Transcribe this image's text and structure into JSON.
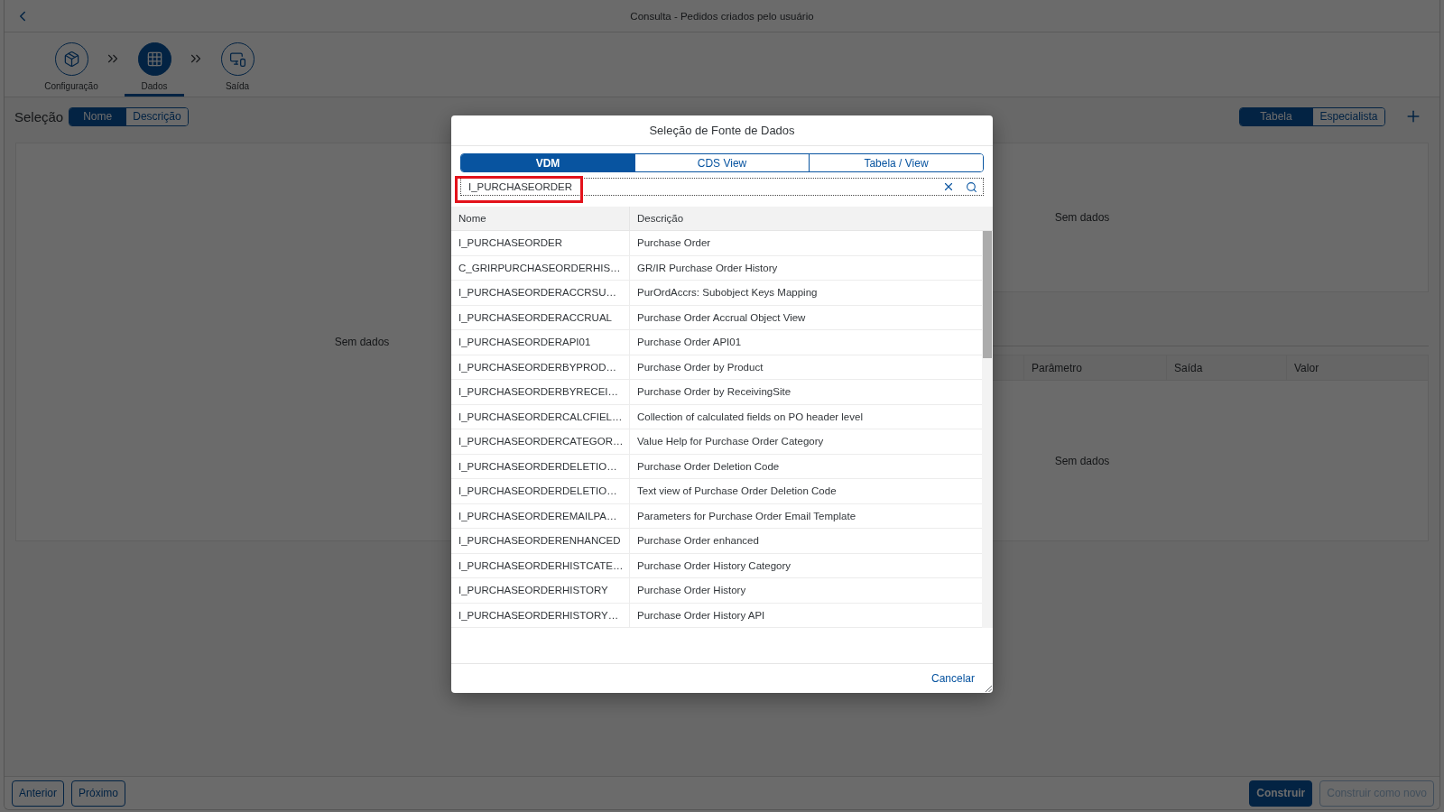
{
  "header": {
    "title": "Consulta - Pedidos criados pelo usuário"
  },
  "wizard": {
    "steps": [
      {
        "label": "Configuração",
        "selected": false
      },
      {
        "label": "Dados",
        "selected": true
      },
      {
        "label": "Saída",
        "selected": false
      }
    ]
  },
  "toolbar": {
    "title": "Seleção",
    "selection_modes": [
      {
        "label": "Nome",
        "selected": true
      },
      {
        "label": "Descrição",
        "selected": false
      }
    ],
    "view_modes": [
      {
        "label": "Tabela",
        "selected": true
      },
      {
        "label": "Especialista",
        "selected": false
      }
    ]
  },
  "selection_panel": {
    "empty_text": "Sem dados"
  },
  "preview_panel": {
    "empty_text": "Sem dados"
  },
  "parameters_table": {
    "columns": [
      "Parâmetro",
      "Saída",
      "Valor"
    ],
    "empty_text": "Sem dados"
  },
  "footer": {
    "left_buttons": [
      {
        "label": "Anterior",
        "kind": "default",
        "disabled": false
      },
      {
        "label": "Próximo",
        "kind": "default",
        "disabled": false
      }
    ],
    "right_buttons": [
      {
        "label": "Construir",
        "kind": "emphasized",
        "disabled": false
      },
      {
        "label": "Construir como novo",
        "kind": "default",
        "disabled": true
      }
    ]
  },
  "dialog": {
    "title": "Seleção de Fonte de Dados",
    "tabs": [
      {
        "label": "VDM",
        "selected": true
      },
      {
        "label": "CDS View",
        "selected": false
      },
      {
        "label": "Tabela / View",
        "selected": false
      }
    ],
    "search": {
      "value": "I_PURCHASEORDER",
      "highlighted": true
    },
    "table": {
      "columns": [
        "Nome",
        "Descrição"
      ],
      "rows": [
        {
          "name": "I_PURCHASEORDER",
          "description": "Purchase Order"
        },
        {
          "name": "C_GRIRPURCHASEORDERHIS…",
          "description": "GR/IR Purchase Order History"
        },
        {
          "name": "I_PURCHASEORDERACCRSU…",
          "description": "PurOrdAccrs: Subobject Keys Mapping"
        },
        {
          "name": "I_PURCHASEORDERACCRUAL",
          "description": "Purchase Order Accrual Object View"
        },
        {
          "name": "I_PURCHASEORDERAPI01",
          "description": "Purchase Order API01"
        },
        {
          "name": "I_PURCHASEORDERBYPROD…",
          "description": "Purchase Order by Product"
        },
        {
          "name": "I_PURCHASEORDERBYRECEI…",
          "description": "Purchase Order by ReceivingSite"
        },
        {
          "name": "I_PURCHASEORDERCALCFIEL…",
          "description": "Collection of calculated fields on PO header level"
        },
        {
          "name": "I_PURCHASEORDERCATEGOR…",
          "description": "Value Help for Purchase Order Category"
        },
        {
          "name": "I_PURCHASEORDERDELETIO…",
          "description": "Purchase Order Deletion Code"
        },
        {
          "name": "I_PURCHASEORDERDELETIO…",
          "description": "Text view of Purchase Order Deletion Code"
        },
        {
          "name": "I_PURCHASEORDEREMAILPA…",
          "description": "Parameters for Purchase Order Email Template"
        },
        {
          "name": "I_PURCHASEORDERENHANCED",
          "description": "Purchase Order enhanced"
        },
        {
          "name": "I_PURCHASEORDERHISTCATE…",
          "description": "Purchase Order History Category"
        },
        {
          "name": "I_PURCHASEORDERHISTORY",
          "description": "Purchase Order History"
        },
        {
          "name": "I_PURCHASEORDERHISTORY…",
          "description": "Purchase Order History API"
        }
      ]
    },
    "buttons": [
      "Cancelar"
    ]
  }
}
